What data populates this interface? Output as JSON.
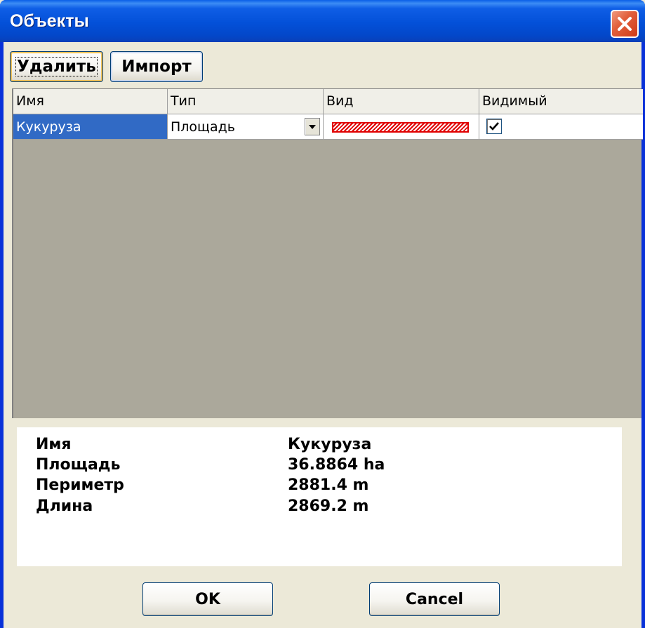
{
  "window": {
    "title": "Объекты"
  },
  "toolbar": {
    "delete_label": "Удалить",
    "import_label": "Импорт"
  },
  "grid": {
    "columns": [
      "Имя",
      "Тип",
      "Вид",
      "Видимый"
    ],
    "rows": [
      {
        "name": "Кукуруза",
        "type": "Площадь",
        "style_icon": "red-hatched-swatch",
        "style_color": "#e00000",
        "visible": true
      }
    ]
  },
  "info": {
    "labels": [
      "Имя",
      "Площадь",
      "Периметр",
      "Длина"
    ],
    "values": [
      "Кукуруза",
      "36.8864 ha",
      "2881.4 m",
      "2869.2 m"
    ]
  },
  "buttons": {
    "ok_label": "OK",
    "cancel_label": "Cancel"
  },
  "colors": {
    "titlebar": "#0350d8",
    "selection": "#316ac5",
    "grid_background": "#aba89b",
    "dialog_background": "#ece9d8"
  }
}
